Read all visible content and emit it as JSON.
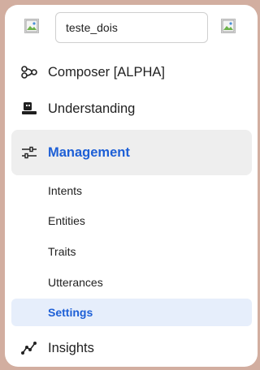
{
  "app_selector": {
    "value": "teste_dois"
  },
  "nav": {
    "composer": {
      "label": "Composer [ALPHA]",
      "icon": "composer-icon"
    },
    "understanding": {
      "label": "Understanding",
      "icon": "understanding-icon"
    },
    "management": {
      "label": "Management",
      "icon": "sliders-icon"
    },
    "insights": {
      "label": "Insights",
      "icon": "insights-icon"
    }
  },
  "management_items": [
    {
      "label": "Intents"
    },
    {
      "label": "Entities"
    },
    {
      "label": "Traits"
    },
    {
      "label": "Utterances"
    },
    {
      "label": "Settings"
    }
  ],
  "colors": {
    "accent": "#1d5fd6",
    "active_bg": "#e6eefb",
    "section_bg": "#eeeeee",
    "frame_bg": "#d2aea0"
  }
}
